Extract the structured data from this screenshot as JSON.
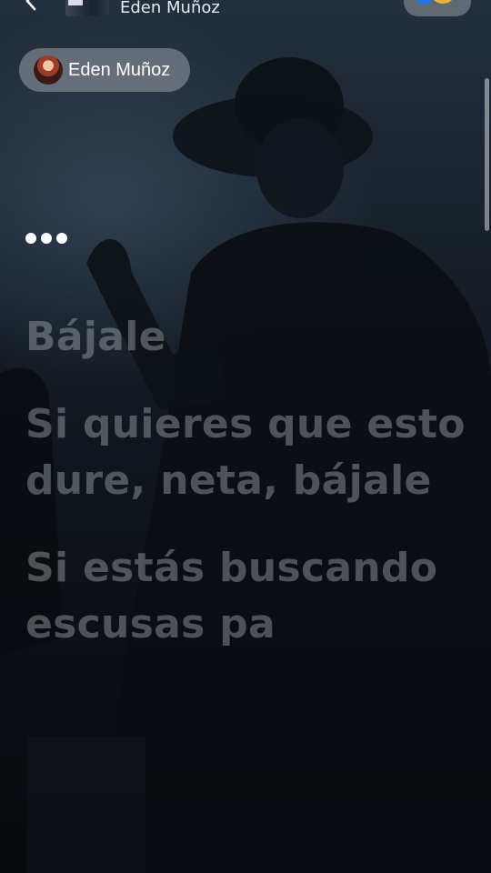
{
  "header": {
    "artist": "Eden Muñoz",
    "colors": {
      "toggle_blue": "#1877f2",
      "toggle_gold": "#e8b23a"
    }
  },
  "artist_chip": {
    "name": "Eden Muñoz"
  },
  "lyrics": {
    "indicator": "•••",
    "lines": [
      "Bájale",
      "Si quieres que esto dure, neta, bájale",
      "Si estás buscando escusas pa"
    ]
  }
}
